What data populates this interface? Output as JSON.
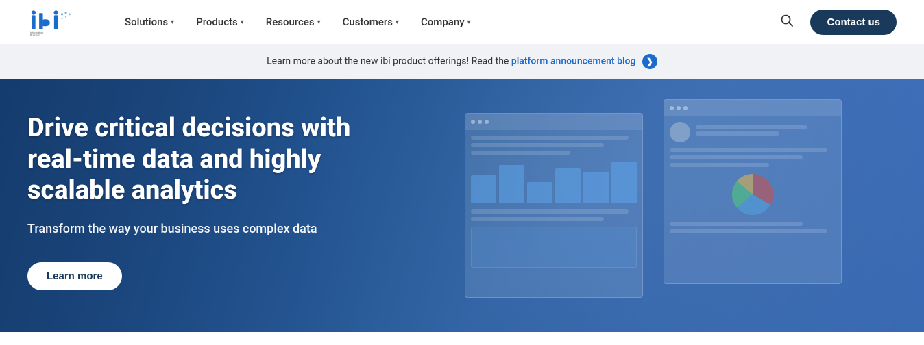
{
  "navbar": {
    "logo_alt": "Information Builders ibi",
    "nav_items": [
      {
        "label": "Solutions",
        "has_dropdown": true
      },
      {
        "label": "Products",
        "has_dropdown": true
      },
      {
        "label": "Resources",
        "has_dropdown": true
      },
      {
        "label": "Customers",
        "has_dropdown": true
      },
      {
        "label": "Company",
        "has_dropdown": true
      }
    ],
    "contact_label": "Contact us",
    "search_placeholder": "Search"
  },
  "announcement": {
    "text": "Learn more about the new ibi product offerings! Read the ",
    "link_text": "platform announcement blog",
    "icon_symbol": "❯"
  },
  "hero": {
    "headline": "Drive critical decisions with real-time data and highly scalable analytics",
    "subtext": "Transform the way your business uses complex data",
    "cta_label": "Learn more"
  }
}
